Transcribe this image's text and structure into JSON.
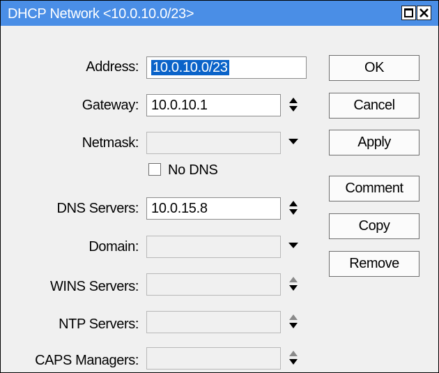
{
  "window": {
    "title": "DHCP Network <10.0.10.0/23>"
  },
  "fields": {
    "address": {
      "label": "Address:",
      "value": "10.0.10.0/23"
    },
    "gateway": {
      "label": "Gateway:",
      "value": "10.0.10.1"
    },
    "netmask": {
      "label": "Netmask:",
      "value": ""
    },
    "no_dns": {
      "label": "No DNS",
      "checked": false
    },
    "dns": {
      "label": "DNS Servers:",
      "value": "10.0.15.8"
    },
    "domain": {
      "label": "Domain:",
      "value": ""
    },
    "wins": {
      "label": "WINS Servers:",
      "value": ""
    },
    "ntp": {
      "label": "NTP Servers:",
      "value": ""
    },
    "caps": {
      "label": "CAPS Managers:",
      "value": ""
    }
  },
  "buttons": {
    "ok": "OK",
    "cancel": "Cancel",
    "apply": "Apply",
    "comment": "Comment",
    "copy": "Copy",
    "remove": "Remove"
  },
  "colors": {
    "titlebar": "#4a8ee6",
    "selection": "#0a63c9",
    "window_bg": "#f0f0f0"
  },
  "icons": [
    "maximize-icon",
    "close-icon",
    "up-down-arrow-icon",
    "dropdown-arrow-icon"
  ]
}
